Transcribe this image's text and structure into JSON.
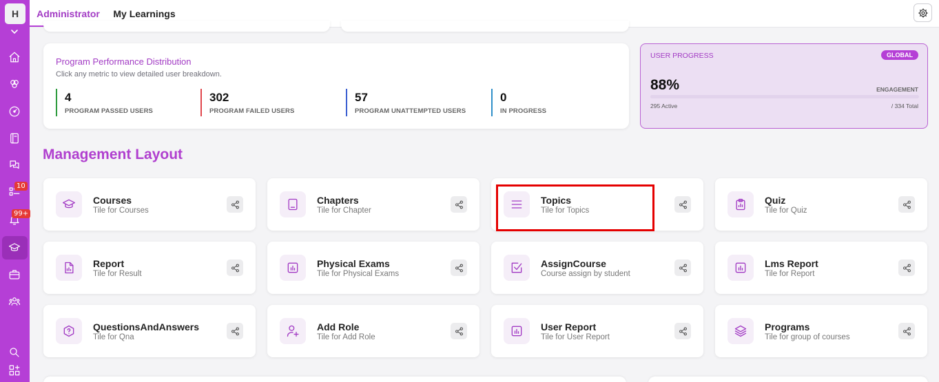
{
  "sidebar": {
    "logo_letter": "H",
    "badge_courses": "10",
    "badge_notifications": "99+"
  },
  "tabs": {
    "administrator": "Administrator",
    "my_learnings": "My Learnings"
  },
  "performance": {
    "title": "Program Performance Distribution",
    "subtitle": "Click any metric to view detailed user breakdown.",
    "metrics": [
      {
        "value": "4",
        "label": "PROGRAM PASSED USERS",
        "color": "#2e9b3e"
      },
      {
        "value": "302",
        "label": "PROGRAM FAILED USERS",
        "color": "#e0454b"
      },
      {
        "value": "57",
        "label": "PROGRAM UNATTEMPTED USERS",
        "color": "#3b5fd1"
      },
      {
        "value": "0",
        "label": "IN PROGRESS",
        "color": "#2f8fc9"
      }
    ]
  },
  "user_progress": {
    "title": "USER PROGRESS",
    "badge": "GLOBAL",
    "percent": "88%",
    "engagement_label": "ENGAGEMENT",
    "active": "295 Active",
    "total": "/ 334 Total",
    "fill_fraction": 0.88
  },
  "section": {
    "title": "Management Layout"
  },
  "tiles": [
    {
      "title": "Courses",
      "subtitle": "Tile for Courses",
      "icon": "graduation-cap-icon"
    },
    {
      "title": "Chapters",
      "subtitle": "Tile for Chapter",
      "icon": "book-icon"
    },
    {
      "title": "Topics",
      "subtitle": "Tile for Topics",
      "icon": "lines-icon"
    },
    {
      "title": "Quiz",
      "subtitle": "Tile for Quiz",
      "icon": "clipboard-icon"
    },
    {
      "title": "Report",
      "subtitle": "Tile for Result",
      "icon": "file-chart-icon"
    },
    {
      "title": "Physical Exams",
      "subtitle": "Tile for Physical Exams",
      "icon": "bar-chart-icon"
    },
    {
      "title": "AssignCourse",
      "subtitle": "Course assign by student",
      "icon": "checkbox-icon"
    },
    {
      "title": "Lms Report",
      "subtitle": "Tile for Report",
      "icon": "bar-chart-icon"
    },
    {
      "title": "QuestionsAndAnswers",
      "subtitle": "Tile for Qna",
      "icon": "question-shield-icon"
    },
    {
      "title": "Add Role",
      "subtitle": "Tile for Add Role",
      "icon": "user-plus-icon"
    },
    {
      "title": "User Report",
      "subtitle": "Tile for User Report",
      "icon": "bar-chart-icon"
    },
    {
      "title": "Programs",
      "subtitle": "Tile for group of courses",
      "icon": "layers-icon"
    }
  ],
  "colors": {
    "brand": "#b53fd6",
    "accent_text": "#a23bc4",
    "highlight": "#e50000"
  }
}
